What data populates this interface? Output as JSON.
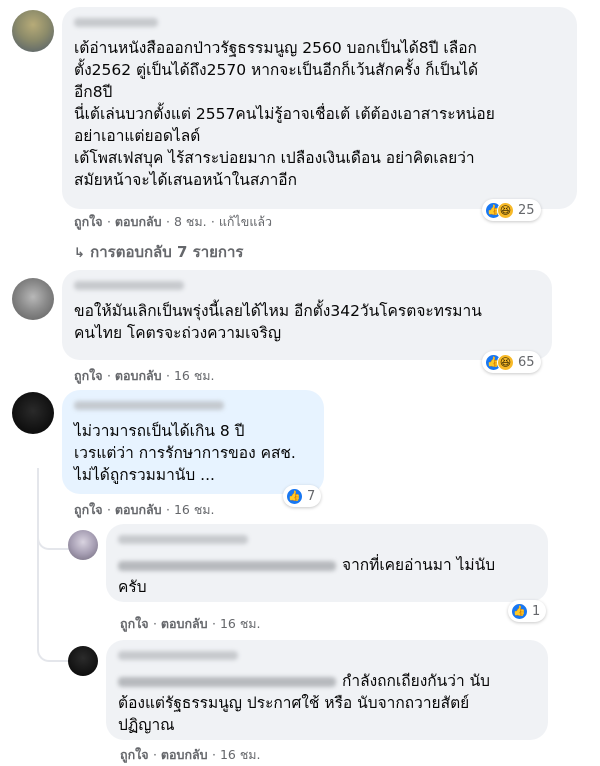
{
  "comments": [
    {
      "lines": [
        "เต้อ่านหนังสือออกป่าวรัฐธรรมนูญ 2560 บอกเป็นได้8ปี เลือก",
        "ตั้ง2562 ตู่เป็นได้ถึง2570 หากจะเป็นอีกก็เว้นสักครั้ง ก็เป็นได้",
        "อีก8ปี",
        "นี่เต้เล่นบวกตั้งแต่ 2557คนไม่รู้อาจเชื่อเต้ เต้ต้องเอาสาระหน่อย",
        "อย่าเอาแต่ยอดไลด์",
        "เต้โพสเฟสบุค ไร้สาระบ่อยมาก เปลืองเงินเดือน อย่าคิดเลยว่า",
        "สมัยหน้าจะได้เสนอหน้าในสภาอีก"
      ],
      "like": "ถูกใจ",
      "reply": "ตอบกลับ",
      "time": "8 ชม.",
      "edited": "แก้ไขแล้ว",
      "reactions": "25"
    },
    {
      "lines": [
        "ขอให้มันเลิกเป็นพรุ่งนี้เลยได้ไหม อีกตั้ง342วันโครตจะทรมาน",
        "คนไทย โคตรจะถ่วงความเจริญ"
      ],
      "like": "ถูกใจ",
      "reply": "ตอบกลับ",
      "time": "16 ชม.",
      "reactions": "65"
    },
    {
      "lines": [
        "ไม่วามารถเป็นได้เกิน 8 ปี",
        "เวรแต่ว่า การรักษาการของ คสช.",
        "ไม่ได้ถูกรวมมานับ ..."
      ],
      "like": "ถูกใจ",
      "reply": "ตอบกลับ",
      "time": "16 ชม.",
      "reactions": "7"
    }
  ],
  "view_replies": "การตอบกลับ 7 รายการ",
  "replies": [
    {
      "lines": [
        "จากที่เคยอ่านมา ไม่นับ",
        "ครับ"
      ],
      "like": "ถูกใจ",
      "reply": "ตอบกลับ",
      "time": "16 ชม.",
      "reactions": "1"
    },
    {
      "lines": [
        "กำลังถกเถียงกันว่า นับ",
        "ต้องแต่รัฐธรรมนูญ ประกาศใช้ หรือ นับจากถวายสัตย์",
        "ปฏิญาณ"
      ],
      "like": "ถูกใจ",
      "reply": "ตอบกลับ",
      "time": "16 ชม."
    }
  ],
  "separator": "·",
  "colors": {
    "like": "#1877f2",
    "haha": "#f7b928",
    "bubble": "#f0f2f5",
    "highlight": "#e7f3ff",
    "meta": "#65676b"
  },
  "icons": {
    "like": "thumbs-up-icon",
    "haha": "laughing-face-icon",
    "reply_arrow": "reply-arrow-icon"
  }
}
